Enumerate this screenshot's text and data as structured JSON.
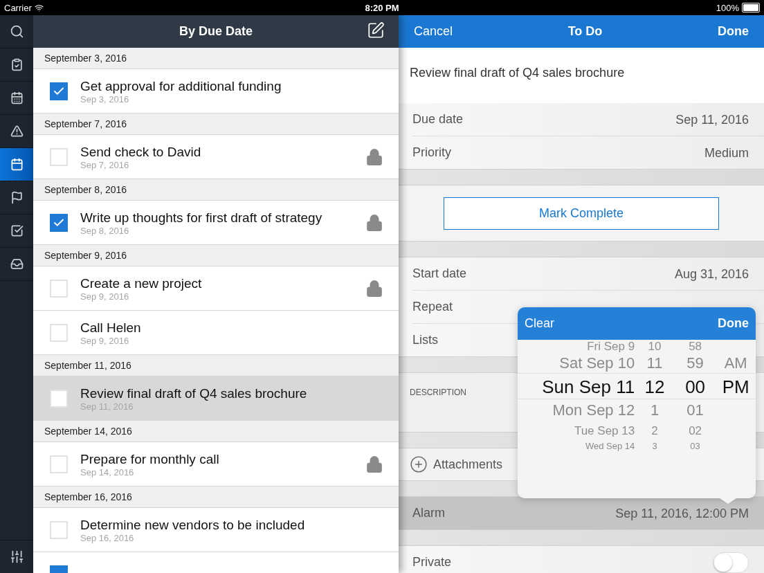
{
  "status_bar": {
    "carrier": "Carrier",
    "time": "8:20 PM",
    "battery": "100%"
  },
  "sidebar": {
    "items": [
      {
        "kind": "clipboard",
        "selected": false
      },
      {
        "kind": "day",
        "selected": false
      },
      {
        "kind": "warning",
        "selected": false
      },
      {
        "kind": "calendar",
        "selected": true
      },
      {
        "kind": "flag",
        "selected": false
      },
      {
        "kind": "checkbox",
        "selected": false
      },
      {
        "kind": "inbox",
        "selected": false
      }
    ]
  },
  "list": {
    "title": "By Due Date",
    "sections": [
      {
        "date": "September 3, 2016",
        "tasks": [
          {
            "title": "Get approval for additional funding",
            "due": "Sep 3, 2016",
            "checked": true,
            "locked": false,
            "selected": false
          }
        ]
      },
      {
        "date": "September 7, 2016",
        "tasks": [
          {
            "title": "Send check to David",
            "due": "Sep 7, 2016",
            "checked": false,
            "locked": true,
            "selected": false
          }
        ]
      },
      {
        "date": "September 8, 2016",
        "tasks": [
          {
            "title": "Write up thoughts for first draft of strategy",
            "due": "Sep 8, 2016",
            "checked": true,
            "locked": true,
            "selected": false
          }
        ]
      },
      {
        "date": "September 9, 2016",
        "tasks": [
          {
            "title": "Create a new project",
            "due": "Sep 9, 2016",
            "checked": false,
            "locked": true,
            "selected": false
          },
          {
            "title": "Call Helen",
            "due": "Sep 9, 2016",
            "checked": false,
            "locked": false,
            "selected": false
          }
        ]
      },
      {
        "date": "September 11, 2016",
        "tasks": [
          {
            "title": "Review final draft of Q4 sales brochure",
            "due": "Sep 11, 2016",
            "checked": false,
            "locked": false,
            "selected": true
          }
        ]
      },
      {
        "date": "September 14, 2016",
        "tasks": [
          {
            "title": "Prepare for monthly call",
            "due": "Sep 14, 2016",
            "checked": false,
            "locked": true,
            "selected": false
          }
        ]
      },
      {
        "date": "September 16, 2016",
        "tasks": [
          {
            "title": "Determine new vendors to be included",
            "due": "Sep 16, 2016",
            "checked": false,
            "locked": false,
            "selected": false
          },
          {
            "checked": true,
            "selected": false
          }
        ]
      }
    ]
  },
  "detail": {
    "cancel": "Cancel",
    "title": "To Do",
    "done": "Done",
    "task_title": "Review final draft of Q4 sales brochure",
    "group_1": [
      {
        "label": "Due date",
        "value": "Sep 11, 2016"
      },
      {
        "label": "Priority",
        "value": "Medium"
      }
    ],
    "action": "Mark Complete",
    "group_2": [
      {
        "label": "Start date",
        "value": "Aug 31, 2016"
      },
      {
        "label": "Repeat"
      },
      {
        "label": "Lists"
      }
    ],
    "description_label": "DESCRIPTION",
    "attachments": "Attachments",
    "alarm": {
      "label": "Alarm",
      "value": "Sep 11, 2016, 12:00 PM",
      "highlighted": true
    },
    "private": {
      "label": "Private",
      "on": false
    }
  },
  "picker": {
    "clear": "Clear",
    "done": "Done",
    "columns": [
      {
        "items": [
          {
            "label": "Fri Sep 9",
            "selected": false
          },
          {
            "label": "Sat Sep 10",
            "selected": false
          },
          {
            "label": "Sun Sep 11",
            "selected": true
          },
          {
            "label": "Mon Sep 12",
            "selected": false
          },
          {
            "label": "Tue Sep 13",
            "selected": false
          },
          {
            "label": "Wed Sep 14",
            "selected": false
          }
        ]
      },
      {
        "items": [
          {
            "label": "10",
            "selected": false
          },
          {
            "label": "11",
            "selected": false
          },
          {
            "label": "12",
            "selected": true
          },
          {
            "label": "1",
            "selected": false
          },
          {
            "label": "2",
            "selected": false
          },
          {
            "label": "3",
            "selected": false
          }
        ]
      },
      {
        "items": [
          {
            "label": "58",
            "selected": false
          },
          {
            "label": "59",
            "selected": false
          },
          {
            "label": "00",
            "selected": true
          },
          {
            "label": "01",
            "selected": false
          },
          {
            "label": "02",
            "selected": false
          },
          {
            "label": "03",
            "selected": false
          }
        ]
      },
      {
        "items": [
          {
            "label": "AM",
            "selected": false
          },
          {
            "label": "PM",
            "selected": true
          }
        ]
      }
    ]
  }
}
